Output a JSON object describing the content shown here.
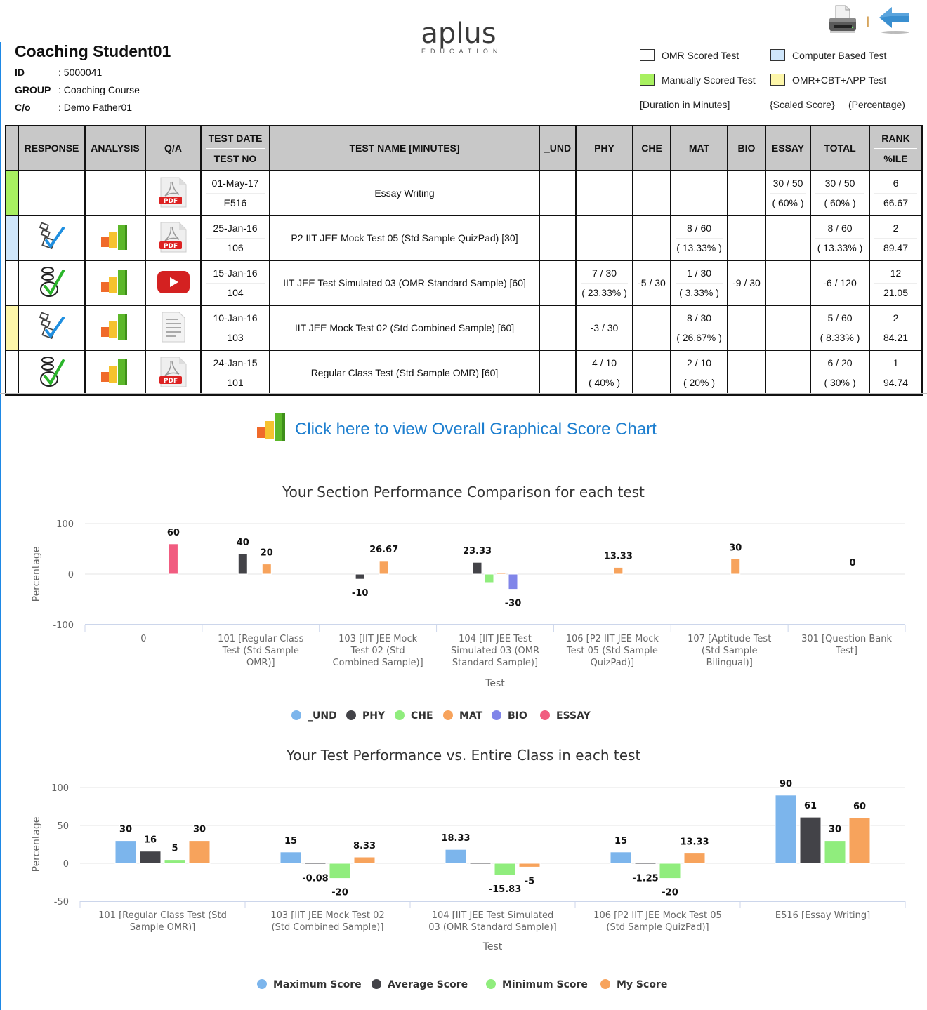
{
  "header": {
    "student_name": "Coaching Student01",
    "info": [
      {
        "key": "ID",
        "value": ": 5000041"
      },
      {
        "key": "GROUP",
        "value": ": Coaching Course"
      },
      {
        "key": "C/o",
        "value": ": Demo Father01"
      }
    ],
    "logo": {
      "word": "aplus",
      "sub": "EDUCATION"
    },
    "print_icon": "printer-icon",
    "back_icon": "back-arrow-icon",
    "separator": "|"
  },
  "legend": {
    "keys": [
      {
        "label": "OMR Scored Test",
        "color": "#ffffff"
      },
      {
        "label": "Computer Based Test",
        "color": "#cfe6fb"
      },
      {
        "label": "Manually Scored Test",
        "color": "#a8f060"
      },
      {
        "label": "OMR+CBT+APP Test",
        "color": "#fdf6a9"
      }
    ],
    "notes": [
      "[Duration in Minutes]",
      "{Scaled Score}",
      "(Percentage)"
    ]
  },
  "table": {
    "headers": {
      "response": "RESPONSE",
      "analysis": "ANALYSIS",
      "qa": "Q/A",
      "test_date": "TEST DATE",
      "test_no": "TEST NO",
      "test_name": "TEST NAME [MINUTES]",
      "und": "_UND",
      "phy": "PHY",
      "che": "CHE",
      "mat": "MAT",
      "bio": "BIO",
      "essay": "ESSAY",
      "total": "TOTAL",
      "rank": "RANK",
      "pctile": "%ILE"
    },
    "rows": [
      {
        "type_color": "#a8f060",
        "response_icon": "",
        "analysis_icon": "",
        "qa_icon": "pdf-icon",
        "date": "01-May-17",
        "no": "E516",
        "name": "Essay Writing",
        "und": "",
        "phy": [
          "",
          ""
        ],
        "che": "",
        "mat": [
          "",
          ""
        ],
        "bio": "",
        "essay": [
          "30 / 50",
          "( 60% )"
        ],
        "total": [
          "30 / 50",
          "( 60% )"
        ],
        "rank": "6",
        "pctile": "66.67"
      },
      {
        "type_color": "#cfe6fb",
        "response_icon": "checkbox-response-icon",
        "analysis_icon": "bar-chart-icon",
        "qa_icon": "pdf-icon",
        "date": "25-Jan-16",
        "no": "106",
        "name": "P2 IIT JEE Mock Test 05 (Std Sample QuizPad) [30]",
        "und": "",
        "phy": [
          "",
          ""
        ],
        "che": "",
        "mat": [
          "8 / 60",
          "( 13.33% )"
        ],
        "bio": "",
        "essay": [
          "",
          ""
        ],
        "total": [
          "8 / 60",
          "( 13.33% )"
        ],
        "rank": "2",
        "pctile": "89.47"
      },
      {
        "type_color": "#ffffff",
        "response_icon": "omr-response-icon",
        "analysis_icon": "bar-chart-icon",
        "qa_icon": "video-play-icon",
        "date": "15-Jan-16",
        "no": "104",
        "name": "IIT JEE Test Simulated 03 (OMR Standard Sample) [60]",
        "und": "",
        "phy": [
          "7 / 30",
          "( 23.33% )"
        ],
        "che": "-5 / 30",
        "mat": [
          "1 / 30",
          "( 3.33% )"
        ],
        "bio": "-9 / 30",
        "essay": [
          "",
          ""
        ],
        "total": [
          "-6 / 120",
          ""
        ],
        "rank": "12",
        "pctile": "21.05"
      },
      {
        "type_color": "#fdf6a9",
        "response_icon": "checkbox-response-icon",
        "analysis_icon": "bar-chart-icon",
        "qa_icon": "document-icon",
        "date": "10-Jan-16",
        "no": "103",
        "name": "IIT JEE Mock Test 02 (Std Combined Sample) [60]",
        "und": "",
        "phy": [
          "-3 / 30",
          ""
        ],
        "che": "",
        "mat": [
          "8 / 30",
          "( 26.67% )"
        ],
        "bio": "",
        "essay": [
          "",
          ""
        ],
        "total": [
          "5 / 60",
          "( 8.33% )"
        ],
        "rank": "2",
        "pctile": "84.21"
      },
      {
        "type_color": "#ffffff",
        "response_icon": "omr-response-icon",
        "analysis_icon": "bar-chart-icon",
        "qa_icon": "pdf-icon",
        "date": "24-Jan-15",
        "no": "101",
        "name": "Regular Class Test (Std Sample OMR) [60]",
        "und": "",
        "phy": [
          "4 / 10",
          "( 40% )"
        ],
        "che": "",
        "mat": [
          "2 / 10",
          "( 20% )"
        ],
        "bio": "",
        "essay": [
          "",
          ""
        ],
        "total": [
          "6 / 20",
          "( 30% )"
        ],
        "rank": "1",
        "pctile": "94.74"
      }
    ]
  },
  "chart_link": {
    "label": "Click here to view Overall Graphical Score Chart",
    "color": "#1e7fcf"
  },
  "chart_data": [
    {
      "type": "bar",
      "title": "Your Section Performance Comparison for each test",
      "xlabel": "Test",
      "ylabel": "Percentage",
      "ylim": [
        -100,
        100
      ],
      "yticks": [
        -100,
        0,
        100
      ],
      "grid": true,
      "legend": "bottom-center",
      "categories": [
        "0",
        "101 [Regular Class Test (Std Sample OMR)]",
        "103 [IIT JEE Mock Test 02 (Std Combined Sample)]",
        "104 [IIT JEE Test Simulated 03 (OMR Standard Sample)]",
        "106 [P2 IIT JEE Mock Test 05 (Std Sample QuizPad)]",
        "107 [Aptitude Test (Std Sample Bilingual)]",
        "301 [Question Bank Test]"
      ],
      "series": [
        {
          "name": "_UND",
          "color": "#7cb5ec",
          "values": [
            null,
            null,
            null,
            null,
            null,
            null,
            null
          ]
        },
        {
          "name": "PHY",
          "color": "#434348",
          "values": [
            null,
            40,
            -10,
            23.33,
            null,
            null,
            null
          ]
        },
        {
          "name": "CHE",
          "color": "#90ed7d",
          "values": [
            null,
            null,
            null,
            -16.67,
            null,
            null,
            null
          ]
        },
        {
          "name": "MAT",
          "color": "#f7a35c",
          "values": [
            null,
            20,
            26.67,
            3.33,
            13.33,
            30,
            0
          ]
        },
        {
          "name": "BIO",
          "color": "#8085e9",
          "values": [
            null,
            null,
            null,
            -30,
            null,
            null,
            null
          ]
        },
        {
          "name": "ESSAY",
          "color": "#f15c80",
          "values": [
            60,
            null,
            null,
            null,
            null,
            null,
            null
          ]
        }
      ],
      "data_labels": [
        {
          "category": 0,
          "series": "ESSAY",
          "text": "60"
        },
        {
          "category": 1,
          "series": "PHY",
          "text": "40"
        },
        {
          "category": 1,
          "series": "MAT",
          "text": "20"
        },
        {
          "category": 2,
          "series": "PHY",
          "text": "-10"
        },
        {
          "category": 2,
          "series": "MAT",
          "text": "26.67"
        },
        {
          "category": 3,
          "series": "PHY",
          "text": "23.33"
        },
        {
          "category": 3,
          "series": "BIO",
          "text": "-30"
        },
        {
          "category": 4,
          "series": "MAT",
          "text": "13.33"
        },
        {
          "category": 5,
          "series": "MAT",
          "text": "30"
        },
        {
          "category": 6,
          "series": "MAT",
          "text": "0"
        }
      ]
    },
    {
      "type": "bar",
      "title": "Your Test Performance vs. Entire Class in each test",
      "xlabel": "Test",
      "ylabel": "Percentage",
      "ylim": [
        -50,
        100
      ],
      "yticks": [
        -50,
        0,
        50,
        100
      ],
      "grid": true,
      "legend": "bottom-center",
      "categories": [
        "101 [Regular Class Test (Std Sample OMR)]",
        "103 [IIT JEE Mock Test 02 (Std Combined Sample)]",
        "104 [IIT JEE Test Simulated 03 (OMR Standard Sample)]",
        "106 [P2 IIT JEE Mock Test 05 (Std Sample QuizPad)]",
        "E516 [Essay Writing]"
      ],
      "series": [
        {
          "name": "Maximum Score",
          "color": "#7cb5ec",
          "values": [
            30,
            15,
            18.33,
            15,
            90
          ]
        },
        {
          "name": "Average Score",
          "color": "#434348",
          "values": [
            16,
            -0.08,
            0.5,
            -1.25,
            61
          ]
        },
        {
          "name": "Minimum Score",
          "color": "#90ed7d",
          "values": [
            5,
            -20,
            -15.83,
            -20,
            30
          ]
        },
        {
          "name": "My Score",
          "color": "#f7a35c",
          "values": [
            30,
            8.33,
            -5,
            13.33,
            60
          ]
        }
      ],
      "data_labels": [
        {
          "category": 0,
          "series": "Maximum Score",
          "text": "30"
        },
        {
          "category": 0,
          "series": "Average Score",
          "text": "16"
        },
        {
          "category": 0,
          "series": "Minimum Score",
          "text": "5"
        },
        {
          "category": 0,
          "series": "My Score",
          "text": "30"
        },
        {
          "category": 1,
          "series": "Maximum Score",
          "text": "15"
        },
        {
          "category": 1,
          "series": "Average Score",
          "text": "-0.08"
        },
        {
          "category": 1,
          "series": "Minimum Score",
          "text": "-20"
        },
        {
          "category": 1,
          "series": "My Score",
          "text": "8.33"
        },
        {
          "category": 2,
          "series": "Maximum Score",
          "text": "18.33"
        },
        {
          "category": 2,
          "series": "Minimum Score",
          "text": "-15.83"
        },
        {
          "category": 2,
          "series": "My Score",
          "text": "-5"
        },
        {
          "category": 3,
          "series": "Maximum Score",
          "text": "15"
        },
        {
          "category": 3,
          "series": "Average Score",
          "text": "-1.25"
        },
        {
          "category": 3,
          "series": "Minimum Score",
          "text": "-20"
        },
        {
          "category": 3,
          "series": "My Score",
          "text": "13.33"
        },
        {
          "category": 4,
          "series": "Maximum Score",
          "text": "90"
        },
        {
          "category": 4,
          "series": "Average Score",
          "text": "61"
        },
        {
          "category": 4,
          "series": "Minimum Score",
          "text": "30"
        },
        {
          "category": 4,
          "series": "My Score",
          "text": "60"
        }
      ]
    }
  ]
}
